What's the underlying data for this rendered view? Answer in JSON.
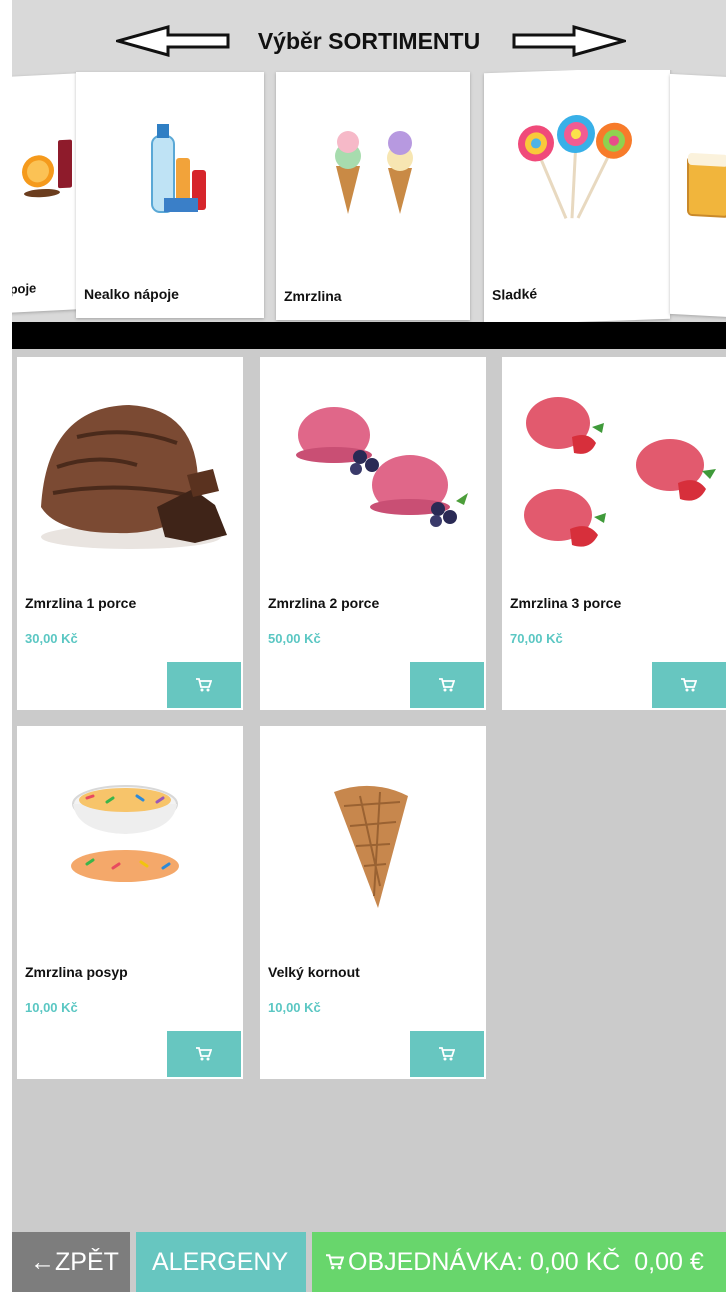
{
  "header": {
    "title": "Výběr SORTIMENTU"
  },
  "categories": [
    {
      "label": "plé nápoje",
      "icon": "orange-drink-image"
    },
    {
      "label": "Nealko nápoje",
      "icon": "soft-drinks-image"
    },
    {
      "label": "Zmrzlina",
      "icon": "ice-cream-cones-image"
    },
    {
      "label": "Sladké",
      "icon": "lollipops-image"
    },
    {
      "label": "",
      "icon": "beer-mug-image"
    }
  ],
  "products": [
    {
      "name": "Zmrzlina 1 porce",
      "price": "30,00 Kč",
      "icon": "chocolate-scoop-image"
    },
    {
      "name": "Zmrzlina 2 porce",
      "price": "50,00 Kč",
      "icon": "berry-scoops-image"
    },
    {
      "name": "Zmrzlina 3 porce",
      "price": "70,00 Kč",
      "icon": "strawberry-scoops-image"
    },
    {
      "name": "Zmrzlina posyp",
      "price": "10,00 Kč",
      "icon": "sprinkles-image"
    },
    {
      "name": "Velký kornout",
      "price": "10,00 Kč",
      "icon": "waffle-cone-image"
    }
  ],
  "footer": {
    "back_label": "←ZPĚT",
    "allergens_label": "ALERGENY",
    "order_label": "OBJEDNÁVKA: 0,00 KČ  0,00 €"
  },
  "colors": {
    "accent_teal": "#67c6c0",
    "price_teal": "#5bc7c3",
    "order_green": "#68d66c",
    "back_gray": "#7d7d7d",
    "background": "#cbcbcb"
  }
}
